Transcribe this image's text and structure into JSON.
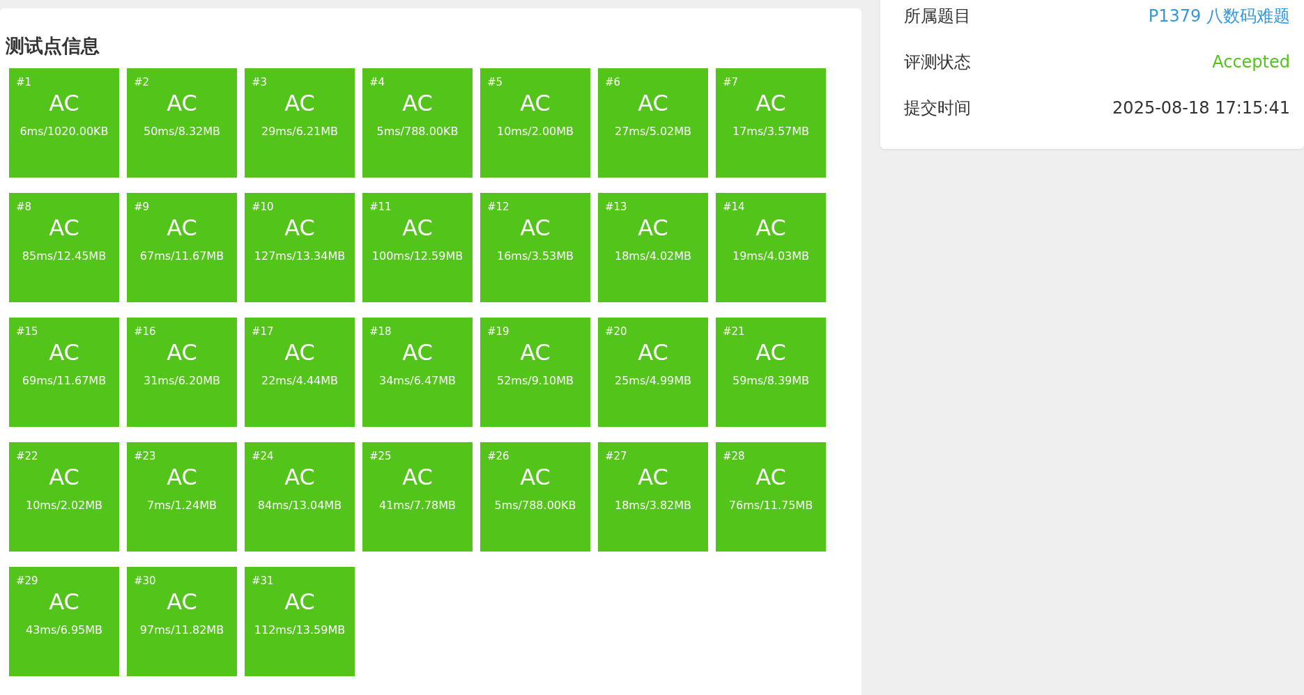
{
  "testcases": {
    "title": "测试点信息",
    "items": [
      {
        "label": "#1",
        "status": "AC",
        "usage": "6ms/1020.00KB"
      },
      {
        "label": "#2",
        "status": "AC",
        "usage": "50ms/8.32MB"
      },
      {
        "label": "#3",
        "status": "AC",
        "usage": "29ms/6.21MB"
      },
      {
        "label": "#4",
        "status": "AC",
        "usage": "5ms/788.00KB"
      },
      {
        "label": "#5",
        "status": "AC",
        "usage": "10ms/2.00MB"
      },
      {
        "label": "#6",
        "status": "AC",
        "usage": "27ms/5.02MB"
      },
      {
        "label": "#7",
        "status": "AC",
        "usage": "17ms/3.57MB"
      },
      {
        "label": "#8",
        "status": "AC",
        "usage": "85ms/12.45MB"
      },
      {
        "label": "#9",
        "status": "AC",
        "usage": "67ms/11.67MB"
      },
      {
        "label": "#10",
        "status": "AC",
        "usage": "127ms/13.34MB"
      },
      {
        "label": "#11",
        "status": "AC",
        "usage": "100ms/12.59MB"
      },
      {
        "label": "#12",
        "status": "AC",
        "usage": "16ms/3.53MB"
      },
      {
        "label": "#13",
        "status": "AC",
        "usage": "18ms/4.02MB"
      },
      {
        "label": "#14",
        "status": "AC",
        "usage": "19ms/4.03MB"
      },
      {
        "label": "#15",
        "status": "AC",
        "usage": "69ms/11.67MB"
      },
      {
        "label": "#16",
        "status": "AC",
        "usage": "31ms/6.20MB"
      },
      {
        "label": "#17",
        "status": "AC",
        "usage": "22ms/4.44MB"
      },
      {
        "label": "#18",
        "status": "AC",
        "usage": "34ms/6.47MB"
      },
      {
        "label": "#19",
        "status": "AC",
        "usage": "52ms/9.10MB"
      },
      {
        "label": "#20",
        "status": "AC",
        "usage": "25ms/4.99MB"
      },
      {
        "label": "#21",
        "status": "AC",
        "usage": "59ms/8.39MB"
      },
      {
        "label": "#22",
        "status": "AC",
        "usage": "10ms/2.02MB"
      },
      {
        "label": "#23",
        "status": "AC",
        "usage": "7ms/1.24MB"
      },
      {
        "label": "#24",
        "status": "AC",
        "usage": "84ms/13.04MB"
      },
      {
        "label": "#25",
        "status": "AC",
        "usage": "41ms/7.78MB"
      },
      {
        "label": "#26",
        "status": "AC",
        "usage": "5ms/788.00KB"
      },
      {
        "label": "#27",
        "status": "AC",
        "usage": "18ms/3.82MB"
      },
      {
        "label": "#28",
        "status": "AC",
        "usage": "76ms/11.75MB"
      },
      {
        "label": "#29",
        "status": "AC",
        "usage": "43ms/6.95MB"
      },
      {
        "label": "#30",
        "status": "AC",
        "usage": "97ms/11.82MB"
      },
      {
        "label": "#31",
        "status": "AC",
        "usage": "112ms/13.59MB"
      }
    ]
  },
  "submission_info": [
    {
      "kind": "link",
      "label": "所属题目",
      "value": "P1379 八数码难题"
    },
    {
      "kind": "status",
      "label": "评测状态",
      "value": "Accepted"
    },
    {
      "kind": "plain",
      "label": "提交时间",
      "value": "2025-08-18 17:15:41"
    }
  ]
}
